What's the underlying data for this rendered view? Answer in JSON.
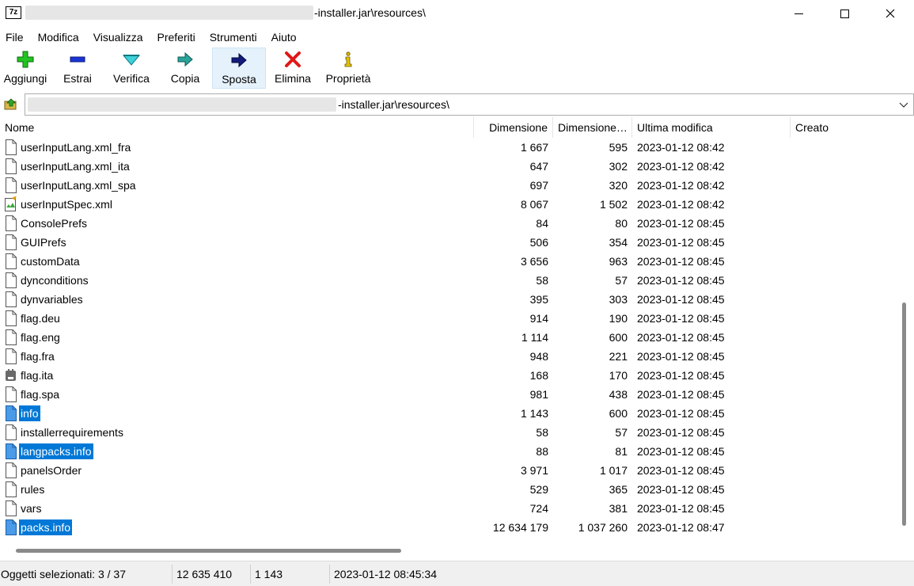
{
  "window": {
    "title_suffix": "-installer.jar\\resources\\",
    "app_icon_text": "7z"
  },
  "menu": [
    "File",
    "Modifica",
    "Visualizza",
    "Preferiti",
    "Strumenti",
    "Aiuto"
  ],
  "toolbar": [
    {
      "label": "Aggiungi",
      "icon": "add-icon"
    },
    {
      "label": "Estrai",
      "icon": "extract-icon"
    },
    {
      "label": "Verifica",
      "icon": "test-icon"
    },
    {
      "label": "Copia",
      "icon": "copy-icon"
    },
    {
      "label": "Sposta",
      "icon": "move-icon"
    },
    {
      "label": "Elimina",
      "icon": "delete-icon"
    },
    {
      "label": "Proprietà",
      "icon": "info-icon"
    }
  ],
  "address": {
    "path_suffix": "-installer.jar\\resources\\"
  },
  "columns": {
    "name": "Nome",
    "size": "Dimensione",
    "packed": "Dimensione…",
    "modified": "Ultima modifica",
    "created": "Creato"
  },
  "files": [
    {
      "name": "userInputLang.xml_fra",
      "size": "1 667",
      "packed": "595",
      "modified": "2023-01-12 08:42",
      "icon": "file-icon",
      "selected": false
    },
    {
      "name": "userInputLang.xml_ita",
      "size": "647",
      "packed": "302",
      "modified": "2023-01-12 08:42",
      "icon": "file-icon",
      "selected": false
    },
    {
      "name": "userInputLang.xml_spa",
      "size": "697",
      "packed": "320",
      "modified": "2023-01-12 08:42",
      "icon": "file-icon",
      "selected": false
    },
    {
      "name": "userInputSpec.xml",
      "size": "8 067",
      "packed": "1 502",
      "modified": "2023-01-12 08:42",
      "icon": "xml-icon",
      "selected": false
    },
    {
      "name": "ConsolePrefs",
      "size": "84",
      "packed": "80",
      "modified": "2023-01-12 08:45",
      "icon": "file-icon",
      "selected": false
    },
    {
      "name": "GUIPrefs",
      "size": "506",
      "packed": "354",
      "modified": "2023-01-12 08:45",
      "icon": "file-icon",
      "selected": false
    },
    {
      "name": "customData",
      "size": "3 656",
      "packed": "963",
      "modified": "2023-01-12 08:45",
      "icon": "file-icon",
      "selected": false
    },
    {
      "name": "dynconditions",
      "size": "58",
      "packed": "57",
      "modified": "2023-01-12 08:45",
      "icon": "file-icon",
      "selected": false
    },
    {
      "name": "dynvariables",
      "size": "395",
      "packed": "303",
      "modified": "2023-01-12 08:45",
      "icon": "file-icon",
      "selected": false
    },
    {
      "name": "flag.deu",
      "size": "914",
      "packed": "190",
      "modified": "2023-01-12 08:45",
      "icon": "file-icon",
      "selected": false
    },
    {
      "name": "flag.eng",
      "size": "1 114",
      "packed": "600",
      "modified": "2023-01-12 08:45",
      "icon": "file-icon",
      "selected": false
    },
    {
      "name": "flag.fra",
      "size": "948",
      "packed": "221",
      "modified": "2023-01-12 08:45",
      "icon": "file-icon",
      "selected": false
    },
    {
      "name": "flag.ita",
      "size": "168",
      "packed": "170",
      "modified": "2023-01-12 08:45",
      "icon": "app-file-icon",
      "selected": false
    },
    {
      "name": "flag.spa",
      "size": "981",
      "packed": "438",
      "modified": "2023-01-12 08:45",
      "icon": "file-icon",
      "selected": false
    },
    {
      "name": "info",
      "size": "1 143",
      "packed": "600",
      "modified": "2023-01-12 08:45",
      "icon": "file-icon",
      "selected": true
    },
    {
      "name": "installerrequirements",
      "size": "58",
      "packed": "57",
      "modified": "2023-01-12 08:45",
      "icon": "file-icon",
      "selected": false
    },
    {
      "name": "langpacks.info",
      "size": "88",
      "packed": "81",
      "modified": "2023-01-12 08:45",
      "icon": "file-icon",
      "selected": true
    },
    {
      "name": "panelsOrder",
      "size": "3 971",
      "packed": "1 017",
      "modified": "2023-01-12 08:45",
      "icon": "file-icon",
      "selected": false
    },
    {
      "name": "rules",
      "size": "529",
      "packed": "365",
      "modified": "2023-01-12 08:45",
      "icon": "file-icon",
      "selected": false
    },
    {
      "name": "vars",
      "size": "724",
      "packed": "381",
      "modified": "2023-01-12 08:45",
      "icon": "file-icon",
      "selected": false
    },
    {
      "name": "packs.info",
      "size": "12 634 179",
      "packed": "1 037 260",
      "modified": "2023-01-12 08:47",
      "icon": "file-icon",
      "selected": true
    }
  ],
  "status": {
    "selected": "Oggetti selezionati: 3 / 37",
    "total_size": "12 635 410",
    "focused_size": "1 143",
    "modified": "2023-01-12 08:45:34"
  },
  "scroll": {
    "vertical_fraction": 0.5,
    "horizontal_fraction": 0.0
  }
}
